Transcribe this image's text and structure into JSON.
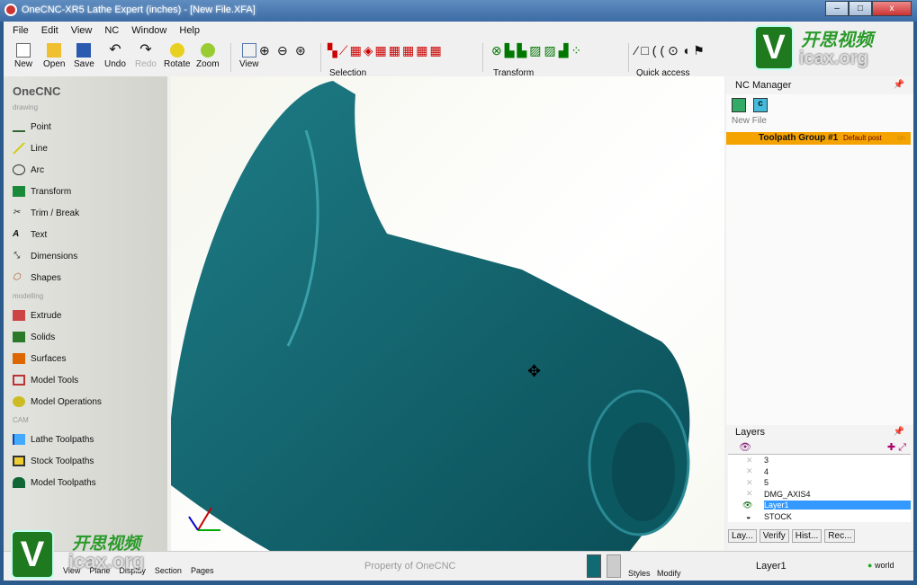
{
  "window": {
    "title": "OneCNC-XR5 Lathe Expert (inches) - [New File.XFA]",
    "min": "–",
    "max": "□",
    "close": "x"
  },
  "menu": [
    "File",
    "Edit",
    "View",
    "NC",
    "Window",
    "Help"
  ],
  "toolbar": {
    "new": "New",
    "open": "Open",
    "save": "Save",
    "undo": "Undo",
    "redo": "Redo",
    "rotate": "Rotate",
    "zoom": "Zoom",
    "view": "View",
    "selection": "Selection",
    "transform": "Transform",
    "quick_access": "Quick access"
  },
  "sidebar": {
    "title": "OneCNC",
    "sections": [
      {
        "label": "drawing",
        "items": [
          "Point",
          "Line",
          "Arc",
          "Transform",
          "Trim / Break",
          "Text",
          "Dimensions",
          "Shapes"
        ]
      },
      {
        "label": "modelling",
        "items": [
          "Extrude",
          "Solids",
          "Surfaces",
          "Model Tools",
          "Model Operations"
        ]
      },
      {
        "label": "CAM",
        "items": [
          "Lathe Toolpaths",
          "Stock Toolpaths",
          "Model Toolpaths"
        ]
      }
    ]
  },
  "nc_manager": {
    "title": "NC Manager",
    "file": "New File",
    "group": "Toolpath Group #1",
    "post": "Default post",
    "state": "on"
  },
  "layers": {
    "title": "Layers",
    "rows": [
      "3",
      "4",
      "5",
      "DMG_AXIS4",
      "Layer1",
      "STOCK"
    ],
    "selected": "Layer1",
    "tabs": [
      "Lay...",
      "Verify",
      "Hist...",
      "Rec..."
    ]
  },
  "statusbar": {
    "buttons": [
      "View",
      "Plane",
      "Display",
      "Section",
      "Pages"
    ],
    "property": "Property of OneCNC",
    "styles": "Styles",
    "modify": "Modify",
    "layer": "Layer1",
    "coord": "world"
  },
  "watermark": {
    "letter": "V",
    "cn": "开思视频",
    "site": "icax.org"
  },
  "colors": {
    "model": "#0f5f68",
    "accent": "#f5a300",
    "selected": "#3399ff"
  }
}
